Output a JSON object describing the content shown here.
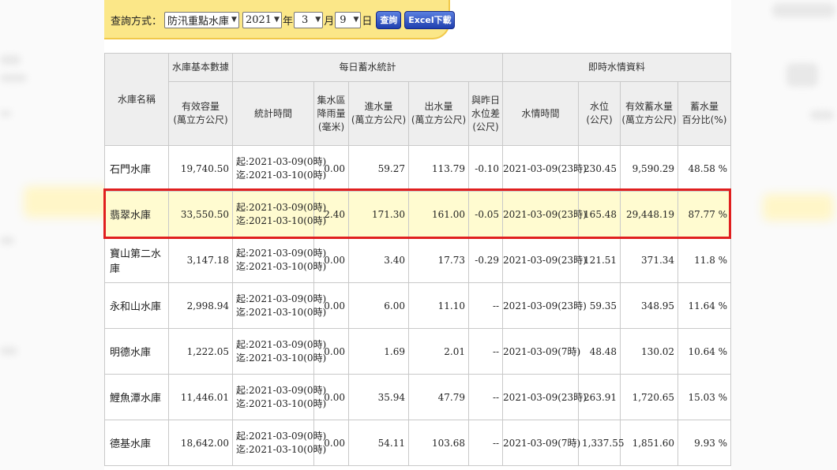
{
  "query": {
    "label": "查詢方式：",
    "type_selected": "防汛重點水庫",
    "year_selected": "2021",
    "year_unit": "年",
    "month_selected": "3",
    "month_unit": "月",
    "day_selected": "9",
    "day_unit": "日",
    "search_label": "查詢",
    "excel_label": "Excel下載"
  },
  "table": {
    "group_headers": {
      "name": "水庫名稱",
      "basic": "水庫基本數據",
      "daily": "每日蓄水統計",
      "realtime": "即時水情資料"
    },
    "columns": {
      "capacity": [
        "有效容量",
        "(萬立方公尺)"
      ],
      "period": "統計時間",
      "rain": [
        "集水區",
        "降雨量",
        "(毫米)"
      ],
      "inflow": [
        "進水量",
        "(萬立方公尺)"
      ],
      "outflow": [
        "出水量",
        "(萬立方公尺)"
      ],
      "level_diff": [
        "與昨日",
        "水位差",
        "(公尺)"
      ],
      "time": "水情時間",
      "level": [
        "水位",
        "(公尺)"
      ],
      "storage": [
        "有效蓄水量",
        "(萬立方公尺)"
      ],
      "percent": [
        "蓄水量",
        "百分比(%)"
      ]
    },
    "rows": [
      {
        "name": "石門水庫",
        "capacity": "19,740.50",
        "start": "起:2021-03-09(0時)",
        "end": "迄:2021-03-10(0時)",
        "rain": "0.00",
        "inflow": "59.27",
        "outflow": "113.79",
        "diff": "-0.10",
        "time": "2021-03-09(23時)",
        "level": "230.45",
        "storage": "9,590.29",
        "percent": "48.58 %"
      },
      {
        "name": "翡翠水庫",
        "capacity": "33,550.50",
        "start": "起:2021-03-09(0時)",
        "end": "迄:2021-03-10(0時)",
        "rain": "2.40",
        "inflow": "171.30",
        "outflow": "161.00",
        "diff": "-0.05",
        "time": "2021-03-09(23時)",
        "level": "165.48",
        "storage": "29,448.19",
        "percent": "87.77 %"
      },
      {
        "name": "寶山第二水庫",
        "capacity": "3,147.18",
        "start": "起:2021-03-09(0時)",
        "end": "迄:2021-03-10(0時)",
        "rain": "0.00",
        "inflow": "3.40",
        "outflow": "17.73",
        "diff": "-0.29",
        "time": "2021-03-09(23時)",
        "level": "121.51",
        "storage": "371.34",
        "percent": "11.8 %"
      },
      {
        "name": "永和山水庫",
        "capacity": "2,998.94",
        "start": "起:2021-03-09(0時)",
        "end": "迄:2021-03-10(0時)",
        "rain": "0.00",
        "inflow": "6.00",
        "outflow": "11.10",
        "diff": "--",
        "time": "2021-03-09(23時)",
        "level": "59.35",
        "storage": "348.95",
        "percent": "11.64 %"
      },
      {
        "name": "明德水庫",
        "capacity": "1,222.05",
        "start": "起:2021-03-09(0時)",
        "end": "迄:2021-03-10(0時)",
        "rain": "0.00",
        "inflow": "1.69",
        "outflow": "2.01",
        "diff": "--",
        "time": "2021-03-09(7時)",
        "level": "48.48",
        "storage": "130.02",
        "percent": "10.64 %"
      },
      {
        "name": "鯉魚潭水庫",
        "capacity": "11,446.01",
        "start": "起:2021-03-09(0時)",
        "end": "迄:2021-03-10(0時)",
        "rain": "0.00",
        "inflow": "35.94",
        "outflow": "47.79",
        "diff": "--",
        "time": "2021-03-09(23時)",
        "level": "263.91",
        "storage": "1,720.65",
        "percent": "15.03 %"
      },
      {
        "name": "德基水庫",
        "capacity": "18,642.00",
        "start": "起:2021-03-09(0時)",
        "end": "迄:2021-03-10(0時)",
        "rain": "0.00",
        "inflow": "54.11",
        "outflow": "103.68",
        "diff": "--",
        "time": "2021-03-09(7時)",
        "level": "1,337.55",
        "storage": "1,851.60",
        "percent": "9.93 %"
      }
    ]
  },
  "highlight": {
    "row_index": 1,
    "color": "#e01f1f"
  }
}
